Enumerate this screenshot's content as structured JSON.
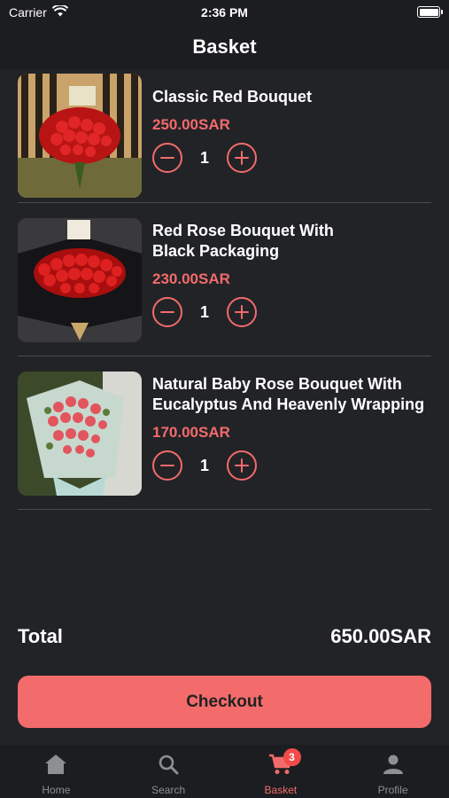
{
  "status": {
    "carrier": "Carrier",
    "time": "2:36 PM"
  },
  "nav": {
    "title": "Basket"
  },
  "items": [
    {
      "name": "Classic Red Bouquet",
      "price": "250.00SAR",
      "qty": "1"
    },
    {
      "name": "Red Rose Bouquet With\nBlack Packaging",
      "price": "230.00SAR",
      "qty": "1"
    },
    {
      "name": "Natural Baby Rose Bouquet With\nEucalyptus And Heavenly Wrapping",
      "price": "170.00SAR",
      "qty": "1"
    }
  ],
  "summary": {
    "total_label": "Total",
    "total_value": "650.00SAR"
  },
  "checkout_label": "Checkout",
  "tabs": [
    {
      "label": "Home",
      "icon": "home-icon"
    },
    {
      "label": "Search",
      "icon": "search-icon"
    },
    {
      "label": "Basket",
      "icon": "cart-icon",
      "badge": "3"
    },
    {
      "label": "Profile",
      "icon": "profile-icon"
    }
  ],
  "colors": {
    "accent": "#f36b6b",
    "background": "#222327",
    "bar": "#1c1d20",
    "badge": "#f34a4a"
  }
}
